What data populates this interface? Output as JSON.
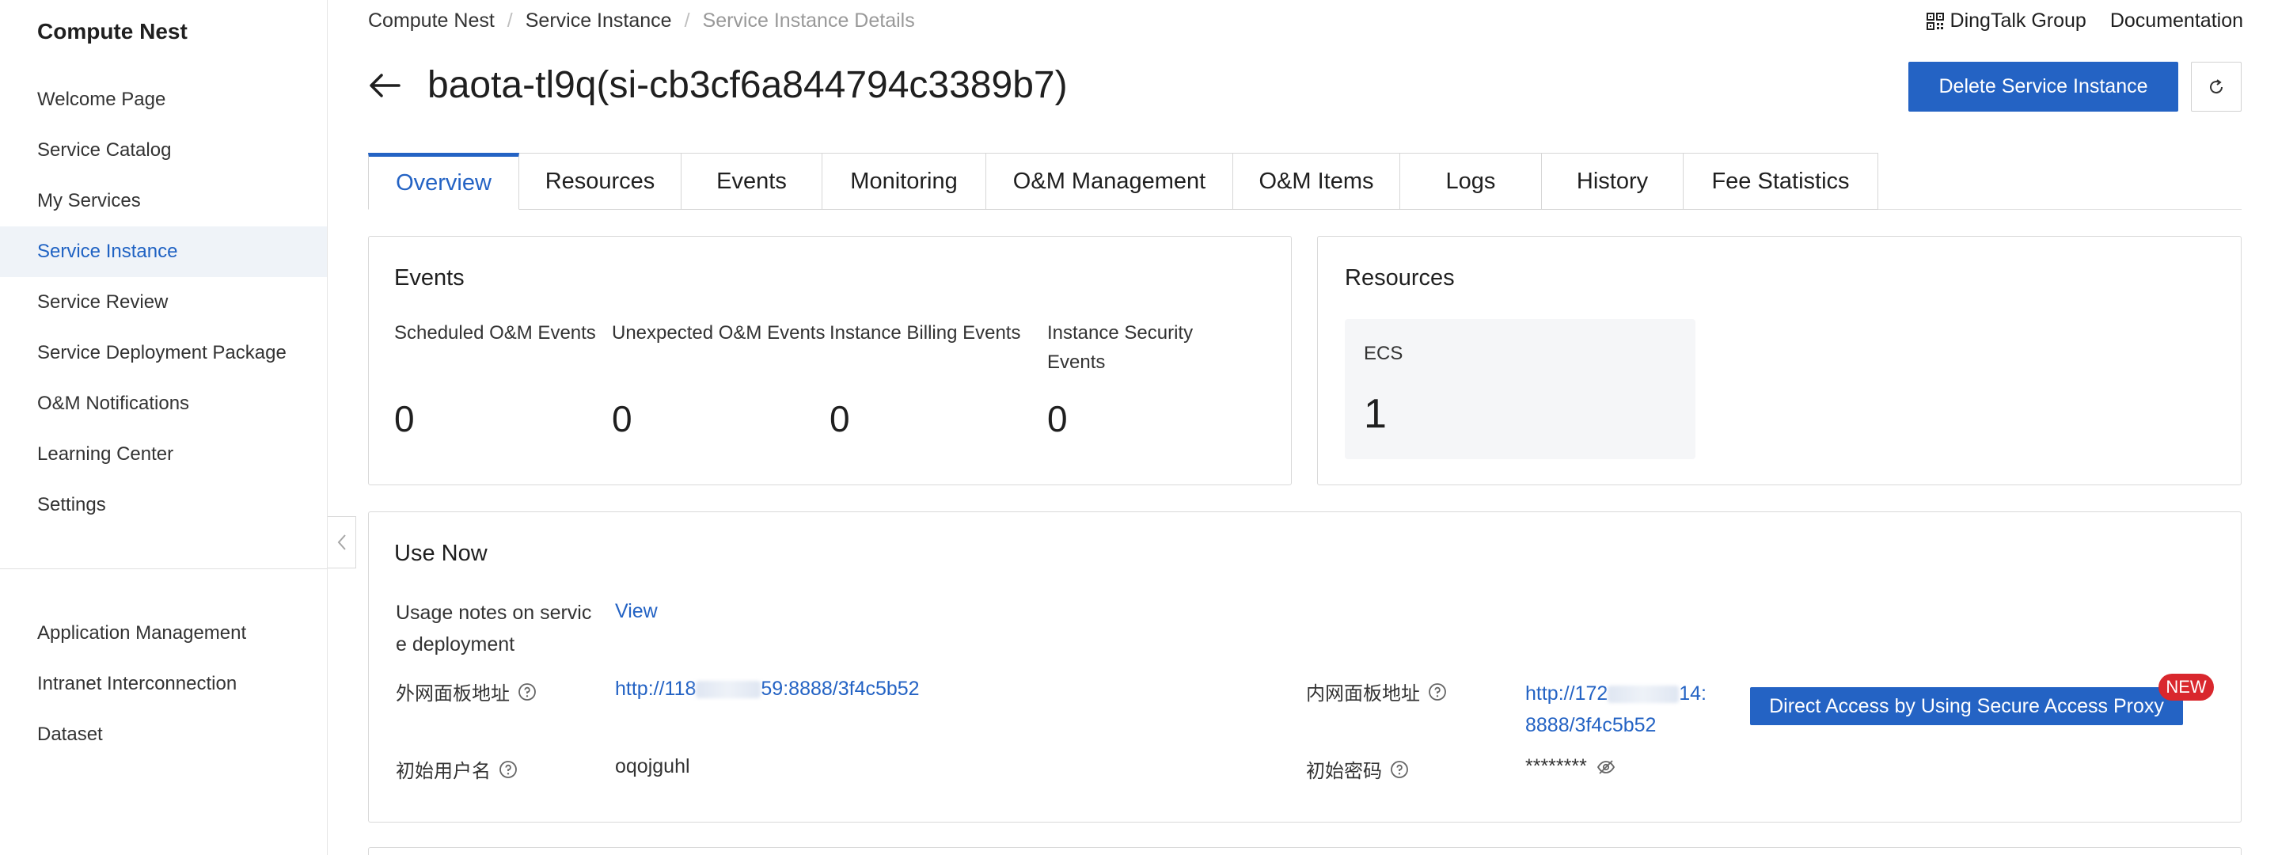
{
  "sidebar": {
    "brand": "Compute Nest",
    "items": [
      {
        "label": "Welcome Page"
      },
      {
        "label": "Service Catalog"
      },
      {
        "label": "My Services"
      },
      {
        "label": "Service Instance"
      },
      {
        "label": "Service Review"
      },
      {
        "label": "Service Deployment Package"
      },
      {
        "label": "O&M Notifications"
      },
      {
        "label": "Learning Center"
      },
      {
        "label": "Settings"
      }
    ],
    "secondary_items": [
      {
        "label": "Application Management"
      },
      {
        "label": "Intranet Interconnection"
      },
      {
        "label": "Dataset"
      }
    ],
    "active_item": "Service Instance"
  },
  "header": {
    "breadcrumb": [
      "Compute Nest",
      "Service Instance",
      "Service Instance Details"
    ],
    "dingtalk_label": "DingTalk Group",
    "documentation_label": "Documentation",
    "title": "baota-tl9q(si-cb3cf6a844794c3389b7)",
    "delete_label": "Delete Service Instance"
  },
  "tabs": [
    {
      "label": "Overview",
      "active": true
    },
    {
      "label": "Resources"
    },
    {
      "label": "Events"
    },
    {
      "label": "Monitoring"
    },
    {
      "label": "O&M Management"
    },
    {
      "label": "O&M Items"
    },
    {
      "label": "Logs"
    },
    {
      "label": "History"
    },
    {
      "label": "Fee Statistics"
    }
  ],
  "events_card": {
    "title": "Events",
    "items": [
      {
        "label": "Scheduled O&M Events",
        "value": "0"
      },
      {
        "label": "Unexpected O&M Events",
        "value": "0"
      },
      {
        "label": "Instance Billing Events",
        "value": "0"
      },
      {
        "label": "Instance Security Events",
        "value": "0"
      }
    ]
  },
  "resources_card": {
    "title": "Resources",
    "ecs_label": "ECS",
    "ecs_count": "1"
  },
  "use_now": {
    "title": "Use Now",
    "usage_notes_label": "Usage notes on servic e deployment",
    "view_link": "View",
    "public_panel_label": "外网面板地址",
    "public_panel_url_start": "http://118",
    "public_panel_url_end": "59:8888/3f4c5b52",
    "private_panel_label": "内网面板地址",
    "private_panel_url_start": "http://172",
    "private_panel_url_mid": "14:",
    "private_panel_url_end": "8888/3f4c5b52",
    "initial_username_label": "初始用户名",
    "initial_username": "oqojguhl",
    "initial_password_label": "初始密码",
    "initial_password": "********",
    "proxy_button_label": "Direct Access by Using Secure Access Proxy",
    "new_badge": "NEW"
  },
  "colors": {
    "primary": "#2463c4",
    "active_bg": "#eff3f8",
    "badge": "#d9272d"
  }
}
